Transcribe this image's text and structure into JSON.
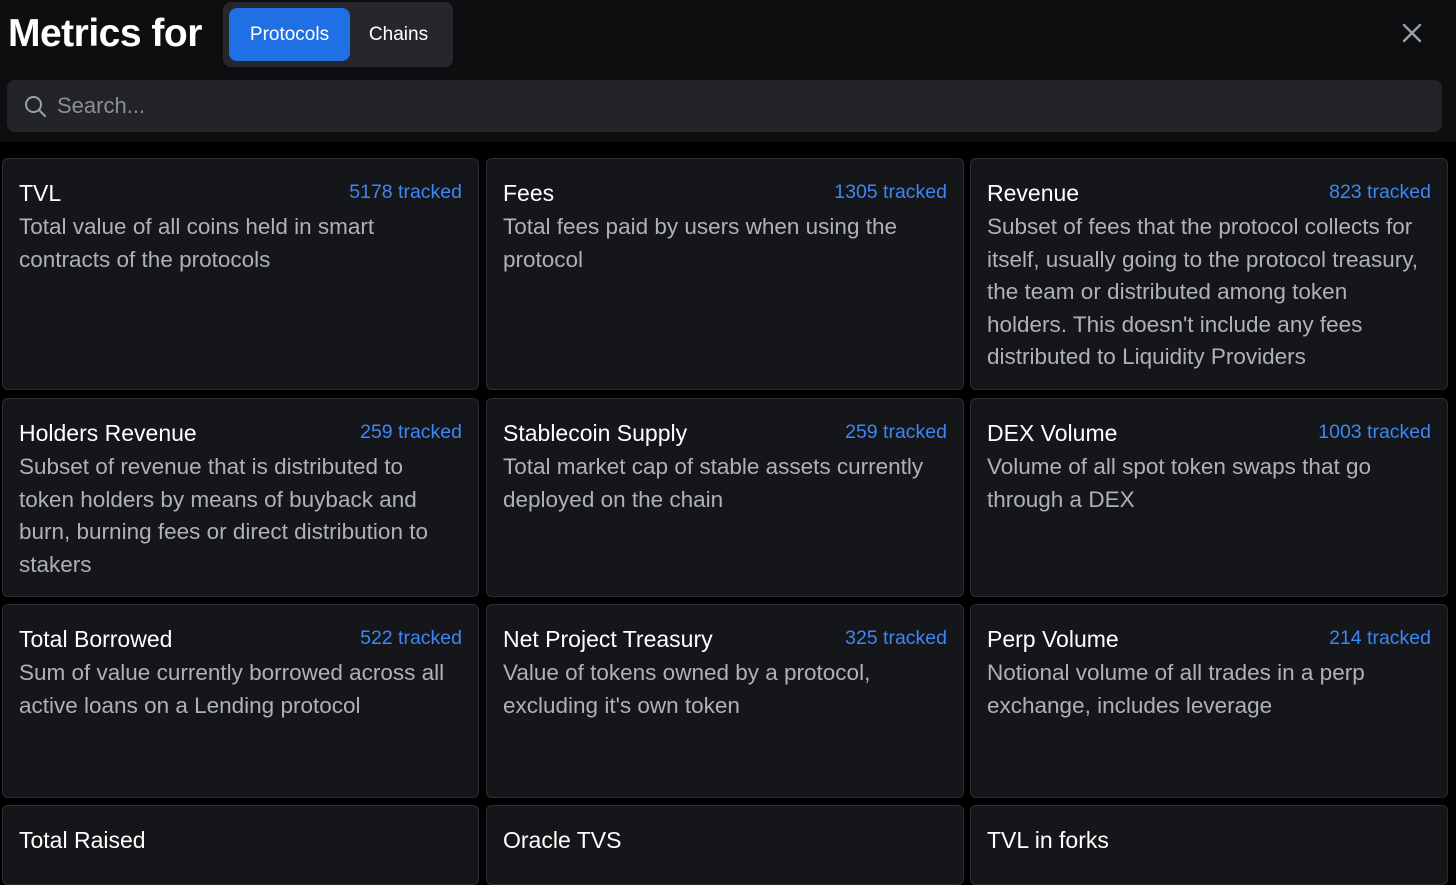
{
  "header": {
    "title": "Metrics for",
    "tabs": [
      {
        "label": "Protocols",
        "active": true
      },
      {
        "label": "Chains",
        "active": false
      }
    ],
    "close_icon": "close-icon"
  },
  "search": {
    "placeholder": "Search...",
    "value": "",
    "icon": "search-icon"
  },
  "colors": {
    "accent": "#1f6fe5",
    "tracked": "#3d86f4",
    "card_bg": "#151619",
    "page_bg": "#000000"
  },
  "metrics": [
    {
      "name": "TVL",
      "tracked": "5178 tracked",
      "description": "Total value of all coins held in smart contracts of the protocols"
    },
    {
      "name": "Fees",
      "tracked": "1305 tracked",
      "description": "Total fees paid by users when using the protocol"
    },
    {
      "name": "Revenue",
      "tracked": "823 tracked",
      "description": "Subset of fees that the protocol collects for itself, usually going to the protocol treasury, the team or distributed among token holders. This doesn't include any fees distributed to Liquidity Providers"
    },
    {
      "name": "Holders Revenue",
      "tracked": "259 tracked",
      "description": "Subset of revenue that is distributed to token holders by means of buyback and burn, burning fees or direct distribution to stakers"
    },
    {
      "name": "Stablecoin Supply",
      "tracked": "259 tracked",
      "description": "Total market cap of stable assets currently deployed on the chain"
    },
    {
      "name": "DEX Volume",
      "tracked": "1003 tracked",
      "description": "Volume of all spot token swaps that go through a DEX"
    },
    {
      "name": "Total Borrowed",
      "tracked": "522 tracked",
      "description": "Sum of value currently borrowed across all active loans on a Lending protocol"
    },
    {
      "name": "Net Project Treasury",
      "tracked": "325 tracked",
      "description": "Value of tokens owned by a protocol, excluding it's own token"
    },
    {
      "name": "Perp Volume",
      "tracked": "214 tracked",
      "description": "Notional volume of all trades in a perp exchange, includes leverage"
    },
    {
      "name": "Total Raised",
      "tracked": "",
      "description": ""
    },
    {
      "name": "Oracle TVS",
      "tracked": "",
      "description": ""
    },
    {
      "name": "TVL in forks",
      "tracked": "",
      "description": ""
    }
  ]
}
